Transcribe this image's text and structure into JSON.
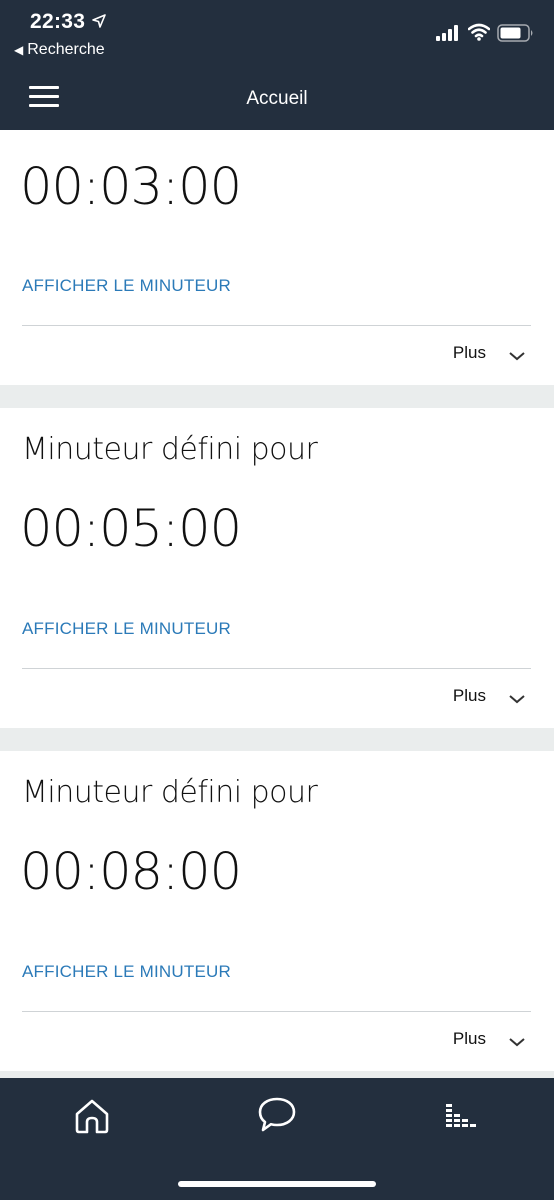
{
  "status_bar": {
    "time": "22:33",
    "back_app": "Recherche"
  },
  "nav": {
    "title": "Accueil"
  },
  "cards": [
    {
      "title": "",
      "time": "00:03:00",
      "action": "AFFICHER LE MINUTEUR",
      "more": "Plus"
    },
    {
      "title": "Minuteur défini pour",
      "time": "00:05:00",
      "action": "AFFICHER LE MINUTEUR",
      "more": "Plus"
    },
    {
      "title": "Minuteur défini pour",
      "time": "00:08:00",
      "action": "AFFICHER LE MINUTEUR",
      "more": "Plus"
    }
  ],
  "tabs": [
    "home-icon",
    "chat-icon",
    "equalizer-icon"
  ],
  "colors": {
    "header_bg": "#232f3e",
    "link": "#2b7ab8",
    "page_bg": "#eaeded"
  }
}
